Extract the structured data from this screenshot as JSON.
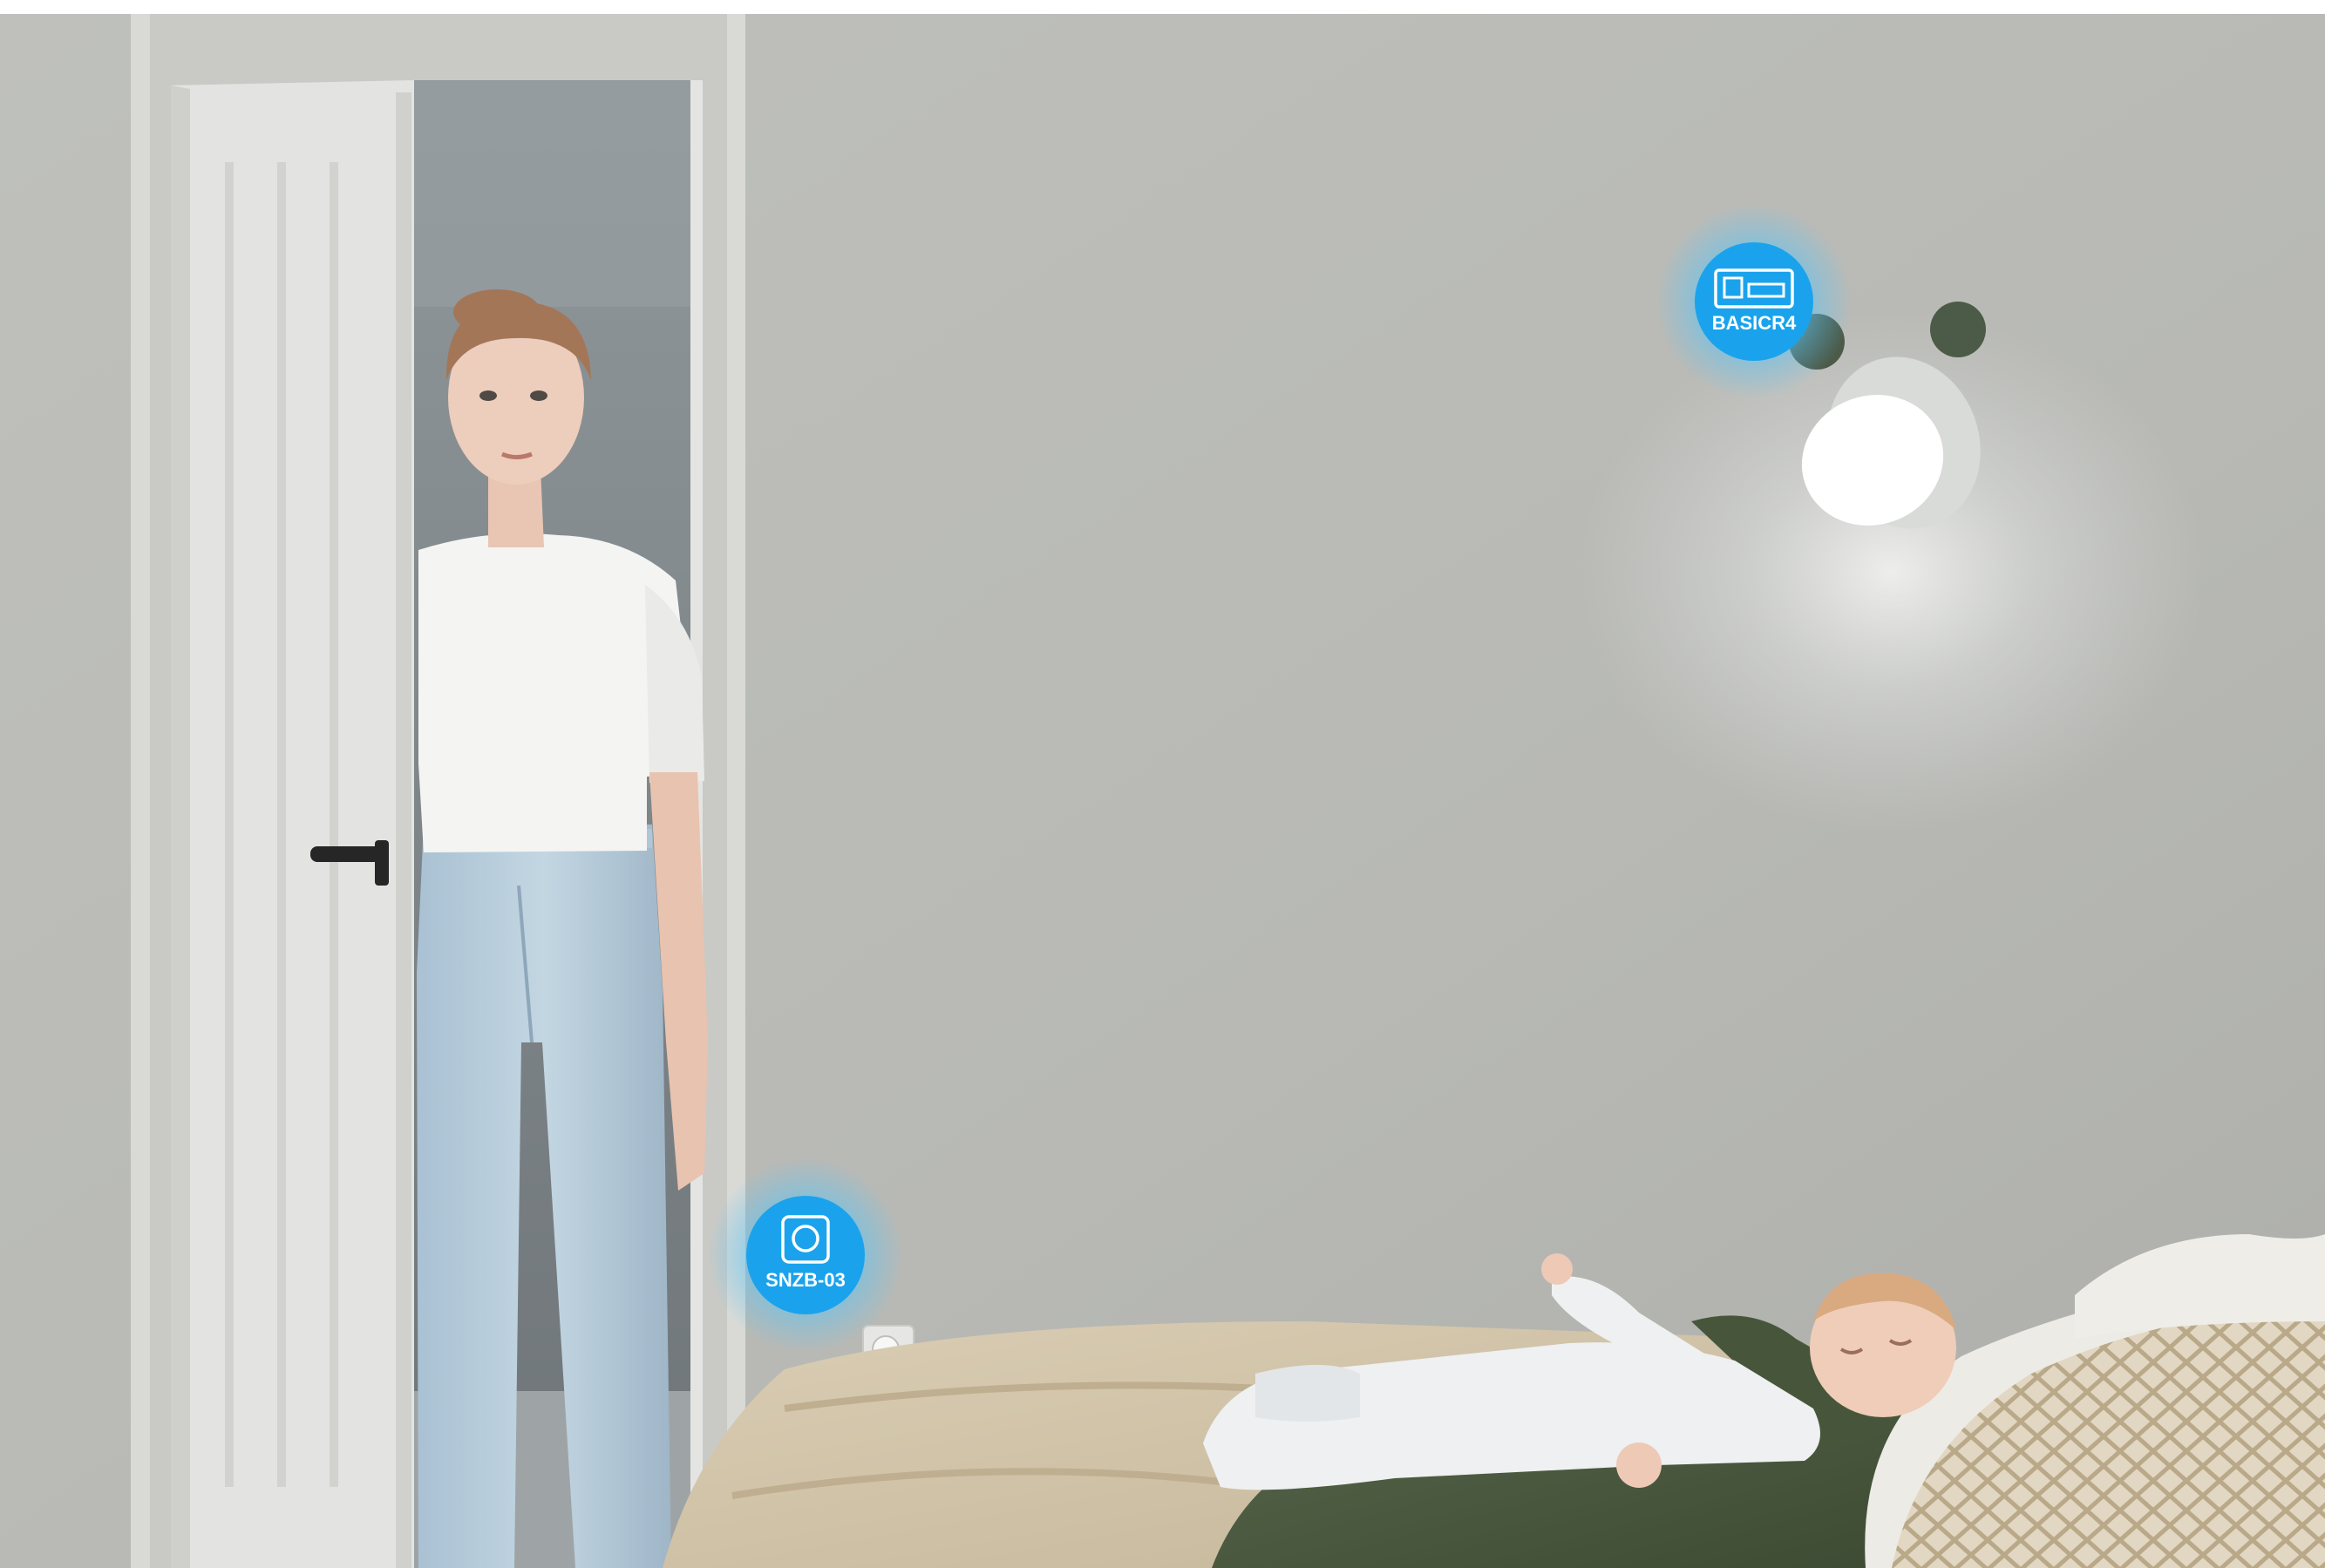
{
  "colors": {
    "badge_fill": "#1aa3ec",
    "badge_glow": "#5cc4f5",
    "badge_text": "#ffffff",
    "wall": "#b9bab6",
    "blanket": "#4a5a3c",
    "bedspread": "#d7c9ae"
  },
  "badges": {
    "relay": {
      "label": "BASICR4",
      "icon": "relay-module-icon"
    },
    "sensor": {
      "label": "SNZB-03",
      "icon": "motion-sensor-icon"
    }
  }
}
